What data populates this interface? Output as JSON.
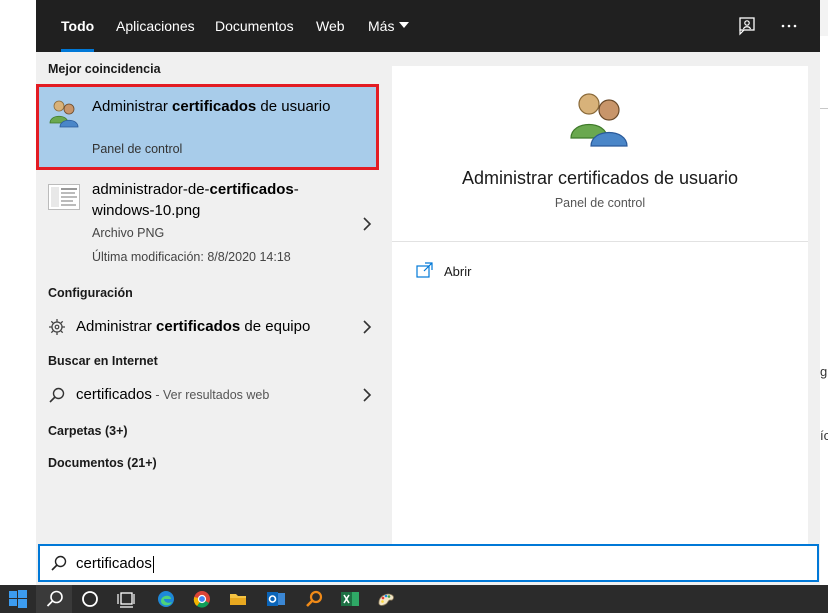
{
  "tabs": [
    {
      "label": "Todo",
      "active": true
    },
    {
      "label": "Aplicaciones",
      "active": false
    },
    {
      "label": "Documentos",
      "active": false
    },
    {
      "label": "Web",
      "active": false
    },
    {
      "label": "Más",
      "active": false
    }
  ],
  "topbar_icons": [
    "feedback-icon",
    "more-options-icon"
  ],
  "more_label": "···",
  "best_match": {
    "header": "Mejor coincidencia",
    "title_pre": "Administrar ",
    "title_bold": "certificados",
    "title_post": " de usuario",
    "subtitle": "Panel de control",
    "icon": "users-icon"
  },
  "file_result": {
    "title_pre": "administrador-de-",
    "title_bold": "certificados",
    "title_post": "-windows-10.png",
    "type": "Archivo PNG",
    "modified": "Última modificación: 8/8/2020 14:18"
  },
  "settings": {
    "header": "Configuración",
    "item_pre": "Administrar ",
    "item_bold": "certificados",
    "item_post": " de equipo"
  },
  "web": {
    "header": "Buscar en Internet",
    "query": "certificados",
    "suffix": " - Ver resultados web"
  },
  "folders": "Carpetas (3+)",
  "documents": "Documentos (21+)",
  "preview": {
    "title": "Administrar certificados de usuario",
    "subtitle": "Panel de control",
    "action": "Abrir"
  },
  "search": {
    "value": "certificados"
  },
  "background_fragments": [
    "g",
    "ío"
  ],
  "colors": {
    "accent": "#0078d7",
    "highlight": "#a8ccea",
    "outline": "#e31c23",
    "topbar": "#202020",
    "taskbar": "#2b2b2b"
  },
  "taskbar_icons": [
    "windows-start-icon",
    "search-icon",
    "cortana-icon",
    "task-view-icon",
    "edge-icon",
    "chrome-icon",
    "file-explorer-icon",
    "outlook-icon",
    "search-app-icon",
    "excel-icon",
    "paint-icon"
  ]
}
